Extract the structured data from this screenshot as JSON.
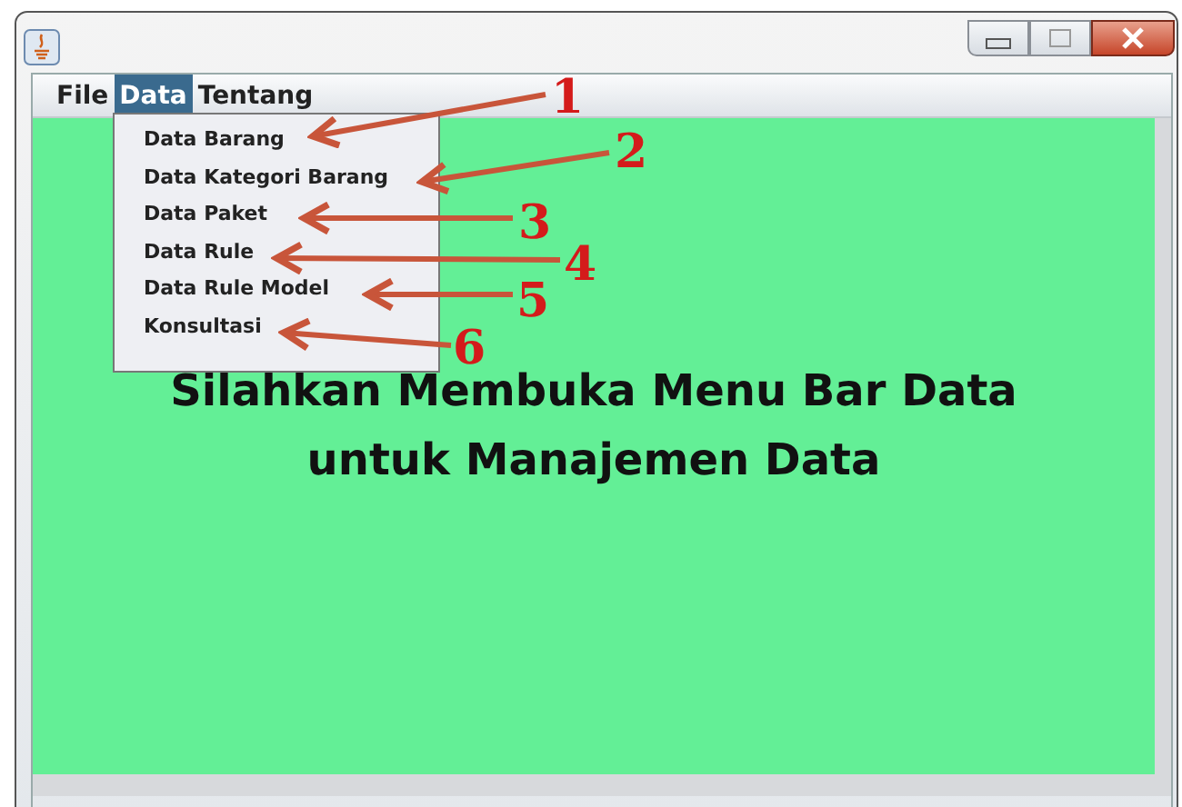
{
  "menu_bar": [
    {
      "label": "File",
      "selected": false
    },
    {
      "label": "Data",
      "selected": true
    },
    {
      "label": "Tentang",
      "selected": false
    }
  ],
  "dropdown": {
    "items": [
      "Data Barang",
      "Data Kategori Barang",
      "Data Paket",
      "Data Rule",
      "Data Rule Model",
      "Konsultasi"
    ]
  },
  "message": [
    "Silahkan Membuka Menu Bar Data",
    "untuk Manajemen Data"
  ],
  "annotations": [
    {
      "label": "1"
    },
    {
      "label": "2"
    },
    {
      "label": "3"
    },
    {
      "label": "4"
    },
    {
      "label": "5"
    },
    {
      "label": "6"
    }
  ]
}
